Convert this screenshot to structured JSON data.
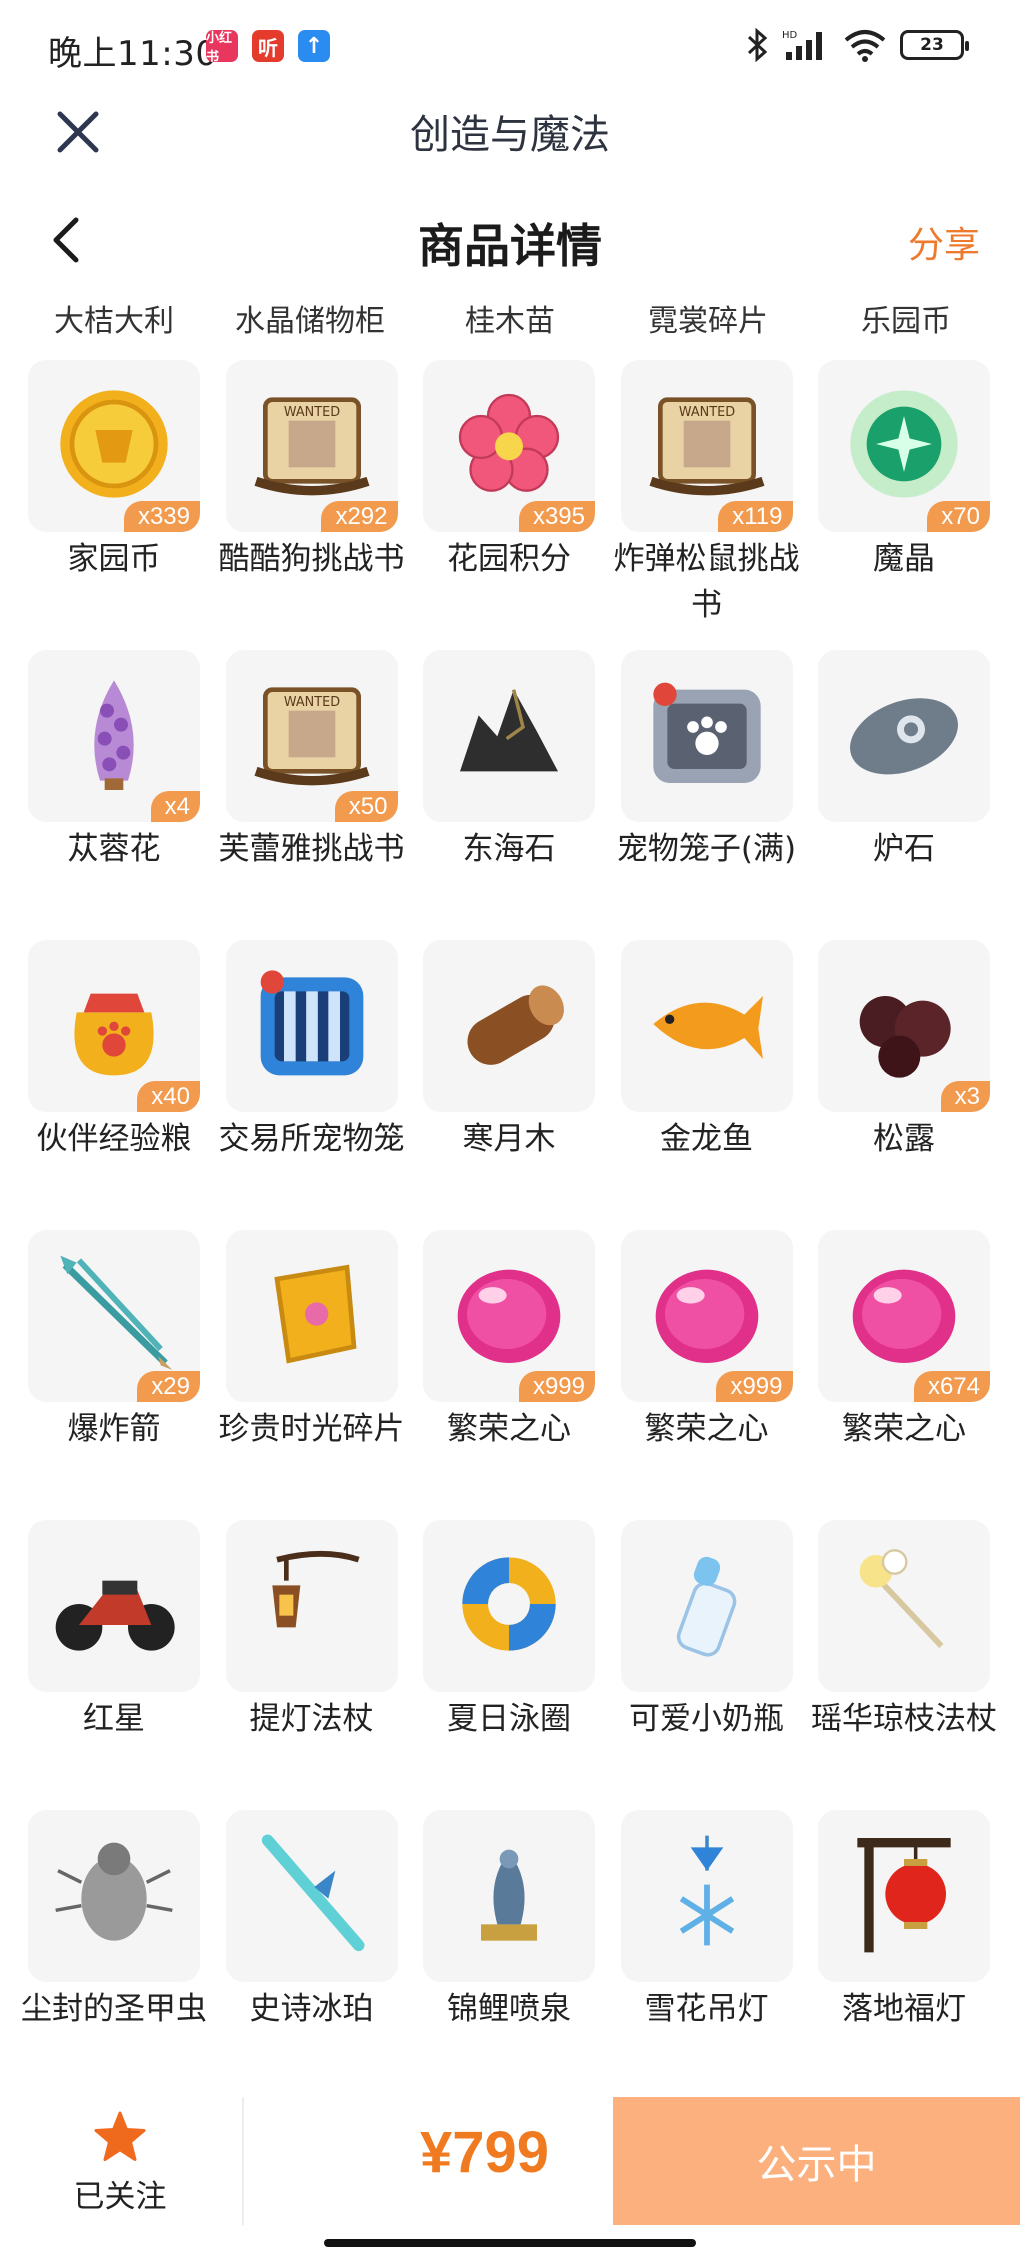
{
  "status_bar": {
    "time": "晚上11:30",
    "apps": [
      {
        "icon": "xiaohongshu-app-icon",
        "label": "小红书",
        "color": "#e8365e"
      },
      {
        "icon": "ting-app-icon",
        "label": "听",
        "color": "#e53b2c"
      },
      {
        "icon": "upload-app-icon",
        "label": "↑",
        "color": "#2a8cf0"
      }
    ],
    "battery": "23"
  },
  "app_header": {
    "title": "创造与魔法",
    "close_icon": "close-icon"
  },
  "page_header": {
    "title": "商品详情",
    "back_icon": "back-arrow-icon",
    "share_label": "分享"
  },
  "clipped_row": [
    "大桔大利",
    "水晶储物柜",
    "桂木苗",
    "霓裳碎片",
    "乐园币"
  ],
  "items": [
    {
      "name": "家园币",
      "qty": "x339",
      "icon": "gold-coin-icon"
    },
    {
      "name": "酷酷狗挑战书",
      "qty": "x292",
      "icon": "wanted-scroll-icon"
    },
    {
      "name": "花园积分",
      "qty": "x395",
      "icon": "flower-badge-icon"
    },
    {
      "name": "炸弹松鼠挑战书",
      "qty": "x119",
      "icon": "wanted-scroll-icon"
    },
    {
      "name": "魔晶",
      "qty": "x70",
      "icon": "green-crystal-icon"
    },
    {
      "name": "苁蓉花",
      "qty": "x4",
      "icon": "purple-flower-icon"
    },
    {
      "name": "芙蕾雅挑战书",
      "qty": "x50",
      "icon": "wanted-scroll-icon"
    },
    {
      "name": "东海石",
      "qty": "",
      "icon": "dark-rock-icon"
    },
    {
      "name": "宠物笼子(满)",
      "qty": "",
      "icon": "pet-cage-full-icon"
    },
    {
      "name": "炉石",
      "qty": "",
      "icon": "hearthstone-icon"
    },
    {
      "name": "伙伴经验粮",
      "qty": "x40",
      "icon": "food-bag-icon"
    },
    {
      "name": "交易所宠物笼",
      "qty": "",
      "icon": "blue-cage-icon"
    },
    {
      "name": "寒月木",
      "qty": "",
      "icon": "wood-log-icon"
    },
    {
      "name": "金龙鱼",
      "qty": "",
      "icon": "golden-fish-icon"
    },
    {
      "name": "松露",
      "qty": "x3",
      "icon": "truffle-icon"
    },
    {
      "name": "爆炸箭",
      "qty": "x29",
      "icon": "arrows-icon"
    },
    {
      "name": "珍贵时光碎片",
      "qty": "",
      "icon": "puzzle-piece-icon"
    },
    {
      "name": "繁荣之心",
      "qty": "x999",
      "icon": "pink-gem-icon"
    },
    {
      "name": "繁荣之心",
      "qty": "x999",
      "icon": "pink-gem-icon"
    },
    {
      "name": "繁荣之心",
      "qty": "x674",
      "icon": "pink-gem-icon"
    },
    {
      "name": "红星",
      "qty": "",
      "icon": "motorcycle-icon"
    },
    {
      "name": "提灯法杖",
      "qty": "",
      "icon": "lantern-staff-icon"
    },
    {
      "name": "夏日泳圈",
      "qty": "",
      "icon": "swim-ring-icon"
    },
    {
      "name": "可爱小奶瓶",
      "qty": "",
      "icon": "milk-bottle-icon"
    },
    {
      "name": "瑶华琼枝法杖",
      "qty": "",
      "icon": "flower-staff-icon"
    },
    {
      "name": "尘封的圣甲虫",
      "qty": "",
      "icon": "beetle-icon"
    },
    {
      "name": "史诗冰珀",
      "qty": "",
      "icon": "ice-sword-icon"
    },
    {
      "name": "锦鲤喷泉",
      "qty": "",
      "icon": "koi-fountain-icon"
    },
    {
      "name": "雪花吊灯",
      "qty": "",
      "icon": "snowflake-lamp-icon"
    },
    {
      "name": "落地福灯",
      "qty": "",
      "icon": "red-lantern-icon"
    }
  ],
  "footer": {
    "follow_label": "已关注",
    "follow_icon": "star-icon",
    "price": "¥799",
    "status_button": "公示中"
  },
  "colors": {
    "accent": "#ee7a2e",
    "badge": "#f29a4e",
    "status_button": "#fbb07e"
  }
}
